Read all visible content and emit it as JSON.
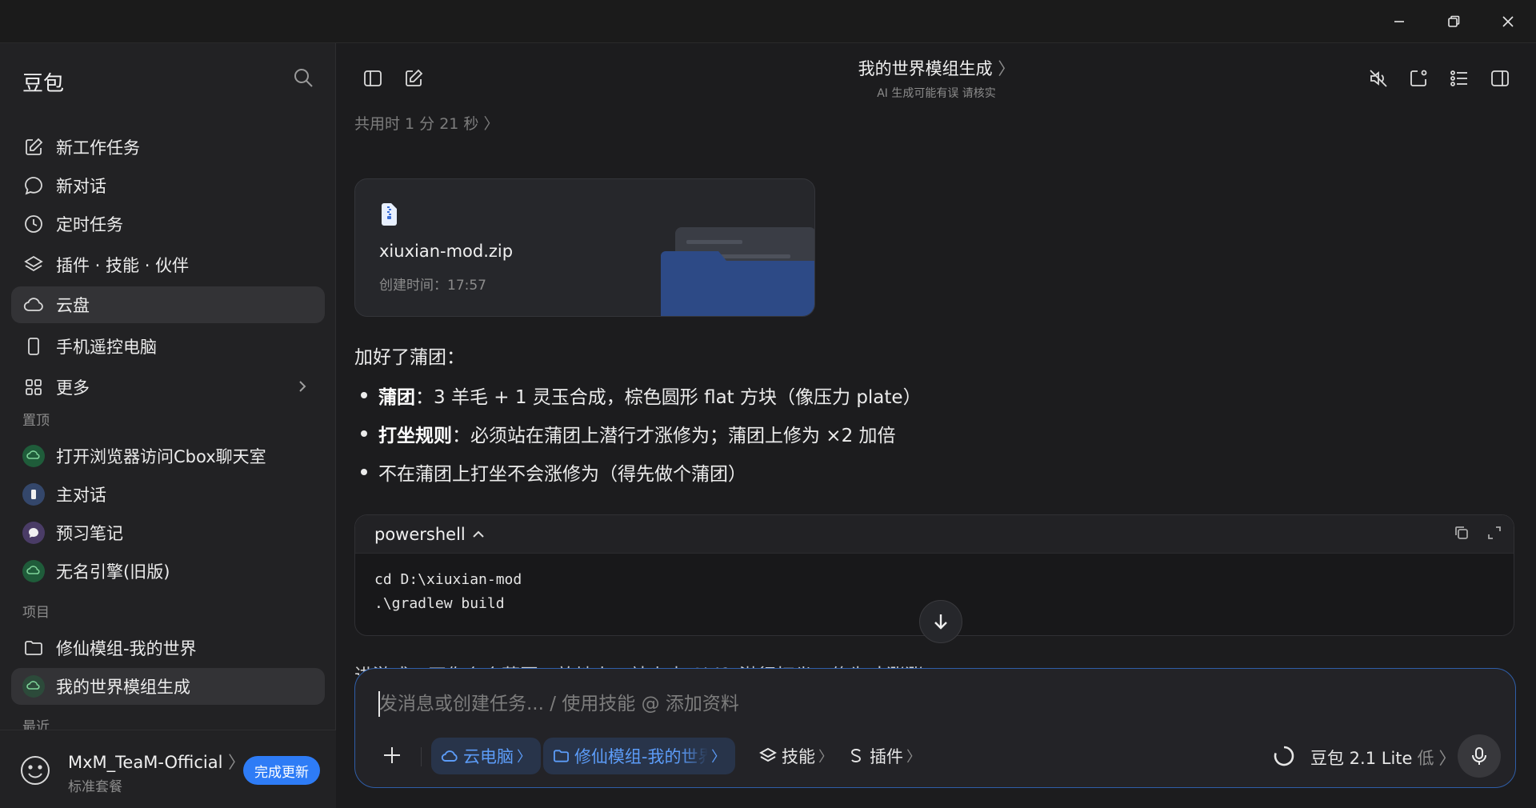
{
  "window": {
    "minimize_label": "minimize",
    "maximize_label": "restore",
    "close_label": "close"
  },
  "sidebar": {
    "brand": "豆包",
    "nav": [
      {
        "label": "新工作任务",
        "icon": "edit-icon"
      },
      {
        "label": "新对话",
        "icon": "chat-bubble-icon"
      },
      {
        "label": "定时任务",
        "icon": "clock-icon"
      },
      {
        "label": "插件 · 技能 · 伙伴",
        "icon": "layers-icon"
      },
      {
        "label": "云盘",
        "icon": "cloud-icon",
        "active": true
      },
      {
        "label": "手机遥控电脑",
        "icon": "phone-icon"
      },
      {
        "label": "更多",
        "icon": "grid-icon"
      }
    ],
    "pinned_label": "置顶",
    "pinned": [
      {
        "label": "打开浏览器访问Cbox聊天室"
      },
      {
        "label": "主对话"
      },
      {
        "label": "预习笔记"
      },
      {
        "label": "无名引擎(旧版)"
      }
    ],
    "projects_label": "项目",
    "projects": [
      {
        "label": "修仙模组-我的世界"
      },
      {
        "label": "我的世界模组生成",
        "active": true
      }
    ],
    "recent_label": "最近",
    "user": {
      "name": "MxM_TeaM-Official",
      "plan": "标准套餐",
      "update_button": "完成更新"
    }
  },
  "header": {
    "title": "我的世界模组生成",
    "subtitle": "AI 生成可能有误 请核实"
  },
  "conversation": {
    "elapsed": "共用时 1 分 21 秒",
    "file": {
      "name": "xiuxian-mod.zip",
      "created": "创建时间：17:57"
    },
    "intro": "加好了蒲团：",
    "bullets": [
      {
        "bold": "蒲团",
        "text": "：3 羊毛 + 1 灵玉合成，棕色圆形 flat 方块（像压力 plate）"
      },
      {
        "bold": "打坐规则",
        "text": "：必须站在蒲团上潜行才涨修为；蒲团上修为 ×2 加倍"
      },
      {
        "bold": "",
        "text": "不在蒲团上打坐不会涨修为（得先做个蒲团）"
      }
    ],
    "code": {
      "language": "powershell",
      "lines": [
        "cd D:\\xiuxian-mod",
        ".\\gradlew build"
      ]
    },
    "partial_text": "进游戏，正你么个蒲团，放地上，站上去 Shift 潜行打坐，修为才涨涨"
  },
  "composer": {
    "placeholder": "发消息或创建任务... / 使用技能 @ 添加资料",
    "chips": {
      "cloud_pc": "云电脑",
      "project": "修仙模组-我的世界",
      "skills": "技能",
      "plugins": "插件"
    },
    "model": "豆包 2.1 Lite",
    "model_level": "低"
  },
  "colors": {
    "accent": "#2e7cf6",
    "chip_blue": "#5c9cf8",
    "background": "#1c1c1e",
    "sidebar": "#222224"
  }
}
